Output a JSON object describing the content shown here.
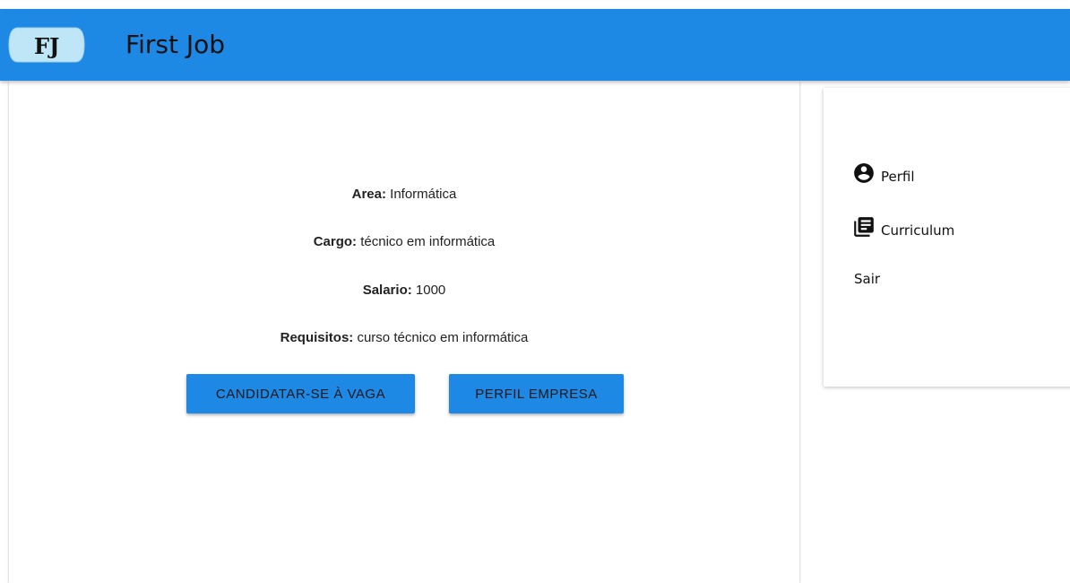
{
  "header": {
    "logo_text": "FJ",
    "title": "First Job",
    "color": "#1e88e5"
  },
  "job": {
    "area_label": "Area:",
    "area_value": "Informática",
    "cargo_label": "Cargo:",
    "cargo_value": "técnico em informática",
    "salario_label": "Salario:",
    "salario_value": "1000",
    "requisitos_label": "Requisitos:",
    "requisitos_value": "curso técnico em informática"
  },
  "actions": {
    "apply_label": "CANDIDATAR-SE À VAGA",
    "company_label": "PERFIL EMPRESA"
  },
  "sidebar": {
    "items": [
      {
        "label": "Perfil",
        "icon": "account-circle-icon"
      },
      {
        "label": "Curriculum",
        "icon": "library-books-icon"
      },
      {
        "label": "Sair",
        "icon": ""
      }
    ]
  }
}
